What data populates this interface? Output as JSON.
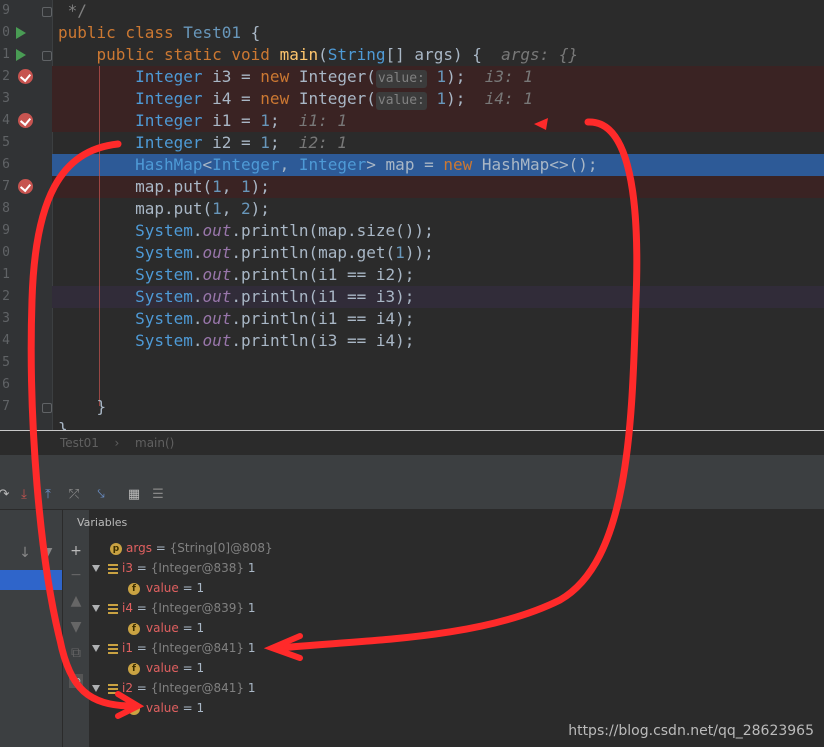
{
  "editor": {
    "lines": [
      {
        "num": "9",
        "text": " */"
      },
      {
        "num": "0",
        "text": "public class Test01 {"
      },
      {
        "num": "1",
        "text": "    public static void main(String[] args) {  args: {}"
      },
      {
        "num": "2",
        "text": "        Integer i3 = new Integer( value: 1);  i3: 1"
      },
      {
        "num": "3",
        "text": "        Integer i4 = new Integer( value: 1);  i4: 1"
      },
      {
        "num": "4",
        "text": "        Integer i1 = 1;  i1: 1"
      },
      {
        "num": "5",
        "text": "        Integer i2 = 1;  i2: 1"
      },
      {
        "num": "6",
        "text": "        HashMap<Integer, Integer> map = new HashMap<>();"
      },
      {
        "num": "7",
        "text": "        map.put(1, 1);"
      },
      {
        "num": "8",
        "text": "        map.put(1, 2);"
      },
      {
        "num": "9",
        "text": "        System.out.println(map.size());"
      },
      {
        "num": "0",
        "text": "        System.out.println(map.get(1));"
      },
      {
        "num": "1",
        "text": "        System.out.println(i1 == i2);"
      },
      {
        "num": "2",
        "text": "        System.out.println(i1 == i3);"
      },
      {
        "num": "3",
        "text": "        System.out.println(i1 == i4);"
      },
      {
        "num": "4",
        "text": "        System.out.println(i3 == i4);"
      },
      {
        "num": "5",
        "text": ""
      },
      {
        "num": "6",
        "text": ""
      },
      {
        "num": "7",
        "text": "    }"
      },
      {
        "num": "",
        "text": "}"
      }
    ]
  },
  "breadcrumb": {
    "class": "Test01",
    "sep": "›",
    "method": "main()"
  },
  "variables": {
    "title": "Variables",
    "rows": [
      {
        "name": "args",
        "ref": "{String[0]@808}",
        "val": ""
      },
      {
        "name": "i3",
        "ref": "{Integer@838}",
        "val": "1"
      },
      {
        "name": "value",
        "ref": "",
        "val": "1"
      },
      {
        "name": "i4",
        "ref": "{Integer@839}",
        "val": "1"
      },
      {
        "name": "value",
        "ref": "",
        "val": "1"
      },
      {
        "name": "i1",
        "ref": "{Integer@841}",
        "val": "1"
      },
      {
        "name": "value",
        "ref": "",
        "val": "1"
      },
      {
        "name": "i2",
        "ref": "{Integer@841}",
        "val": "1"
      },
      {
        "name": "value",
        "ref": "",
        "val": "1"
      }
    ],
    "eq": "="
  },
  "watermark": "https://blog.csdn.net/qq_28623965",
  "colors": {
    "annotation": "#ff2a2a",
    "current_line": "#2d5a97",
    "breakpoint": "#c75450"
  }
}
